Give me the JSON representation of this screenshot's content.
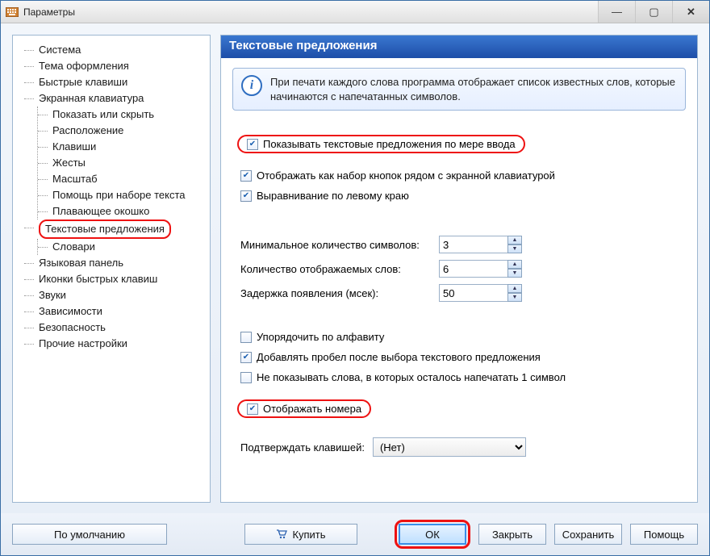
{
  "window": {
    "title": "Параметры"
  },
  "tree": {
    "items": [
      "Система",
      "Тема оформления",
      "Быстрые клавиши",
      "Экранная клавиатура",
      "Текстовые предложения",
      "Языковая панель",
      "Иконки быстрых клавиш",
      "Звуки",
      "Зависимости",
      "Безопасность",
      "Прочие настройки"
    ],
    "keyboard_children": [
      "Показать или скрыть",
      "Расположение",
      "Клавиши",
      "Жесты",
      "Масштаб",
      "Помощь при наборе текста",
      "Плавающее окошко"
    ],
    "text_children": [
      "Словари"
    ]
  },
  "header": "Текстовые предложения",
  "info": "При печати каждого слова программа отображает список известных слов, которые начинаются с напечатанных символов.",
  "checkboxes": {
    "show_suggestions": {
      "label": "Показывать текстовые предложения по мере ввода",
      "checked": true
    },
    "as_buttons": {
      "label": "Отображать как набор кнопок рядом с экранной клавиатурой",
      "checked": true
    },
    "left_align": {
      "label": "Выравнивание по левому краю",
      "checked": true
    },
    "alpha_sort": {
      "label": "Упорядочить по алфавиту",
      "checked": false
    },
    "add_space": {
      "label": "Добавлять пробел после выбора текстового предложения",
      "checked": true
    },
    "hide_one_left": {
      "label": "Не показывать слова, в которых осталось напечатать 1 символ",
      "checked": false
    },
    "show_numbers": {
      "label": "Отображать номера",
      "checked": true
    }
  },
  "numbers": {
    "min_chars": {
      "label": "Минимальное количество символов:",
      "value": "3"
    },
    "word_count": {
      "label": "Количество отображаемых слов:",
      "value": "6"
    },
    "delay_ms": {
      "label": "Задержка появления (мсек):",
      "value": "50"
    }
  },
  "confirm": {
    "label": "Подтверждать клавишей:",
    "value": "(Нет)"
  },
  "footer": {
    "defaults": "По умолчанию",
    "buy": "Купить",
    "ok": "ОК",
    "close": "Закрыть",
    "save": "Сохранить",
    "help": "Помощь"
  }
}
